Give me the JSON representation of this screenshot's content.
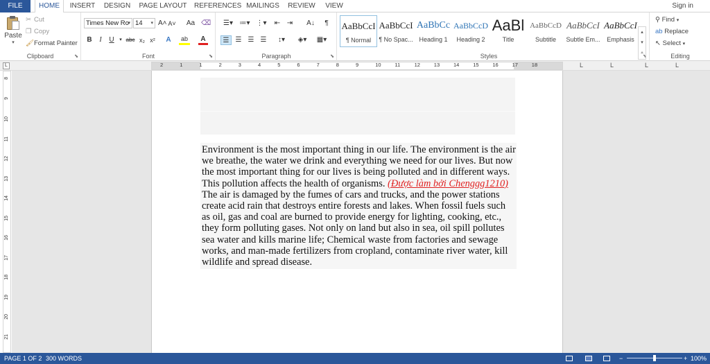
{
  "tabs": [
    {
      "label": "FILE"
    },
    {
      "label": "HOME"
    },
    {
      "label": "INSERT"
    },
    {
      "label": "DESIGN"
    },
    {
      "label": "PAGE LAYOUT"
    },
    {
      "label": "REFERENCES"
    },
    {
      "label": "MAILINGS"
    },
    {
      "label": "REVIEW"
    },
    {
      "label": "VIEW"
    }
  ],
  "signin": "Sign in",
  "clipboard": {
    "paste": "Paste",
    "cut": "Cut",
    "copy": "Copy",
    "format_painter": "Format Painter",
    "label": "Clipboard"
  },
  "font": {
    "name": "Times New Ro",
    "size": "14",
    "label": "Font",
    "bold": "B",
    "italic": "I",
    "underline": "U",
    "strike": "abc",
    "subscript": "x₂",
    "superscript": "x²",
    "grow": "A˄",
    "shrink": "A˅",
    "change_case": "Aa",
    "effects": "A",
    "highlight": "ab",
    "font_color": "A"
  },
  "paragraph": {
    "label": "Paragraph",
    "show_marks": "¶",
    "sort": "A↓"
  },
  "styles": {
    "label": "Styles",
    "items": [
      {
        "preview": "AaBbCcI",
        "name": "¶ Normal"
      },
      {
        "preview": "AaBbCcI",
        "name": "¶ No Spac..."
      },
      {
        "preview": "AaBbCc",
        "name": "Heading 1"
      },
      {
        "preview": "AaBbCcD",
        "name": "Heading 2"
      },
      {
        "preview": "AaBl",
        "name": "Title"
      },
      {
        "preview": "AaBbCcD",
        "name": "Subtitle"
      },
      {
        "preview": "AaBbCcI",
        "name": "Subtle Em..."
      },
      {
        "preview": "AaBbCcI",
        "name": "Emphasis"
      }
    ]
  },
  "editing": {
    "find": "Find",
    "replace": "Replace",
    "select": "Select",
    "label": "Editing"
  },
  "ruler": {
    "numbers": [
      "2",
      "1",
      "1",
      "2",
      "3",
      "4",
      "5",
      "6",
      "7",
      "8",
      "9",
      "10",
      "11",
      "12",
      "13",
      "14",
      "15",
      "16",
      "17",
      "18"
    ],
    "corner": "L"
  },
  "vruler": {
    "numbers": [
      "8",
      "9",
      "10",
      "11",
      "12",
      "13",
      "14",
      "15",
      "16",
      "17",
      "18",
      "19",
      "20",
      "21"
    ]
  },
  "document": {
    "paragraph_before": "Environment is the most important thing in our life. The environment is the air we breathe, the water we drink and everything we need for our lives. But now the most important thing for our lives is being polluted and in different ways. This pollution affects the health of organisms. ",
    "red_link": "(Được làm bởi Chenggg1210)",
    "paragraph_after": "The air is damaged by the fumes of cars and trucks, and the power stations create acid rain that destroys entire forests and lakes. When fossil fuels such as oil, gas and coal are burned to provide energy for lighting, cooking, etc., they form polluting gases. Not only on land but also in sea, oil spill pollutes sea water and kills marine life; Chemical waste from factories and sewage works, and man-made fertilizers from cropland, contaminate river water, kill wildlife and spread disease."
  },
  "status": {
    "page": "PAGE 1 OF 2",
    "words": "300 WORDS",
    "zoom": "100%",
    "zoom_fraction": 0.5
  },
  "colors": {
    "accent": "#2b579a",
    "link_red": "#e02020"
  }
}
